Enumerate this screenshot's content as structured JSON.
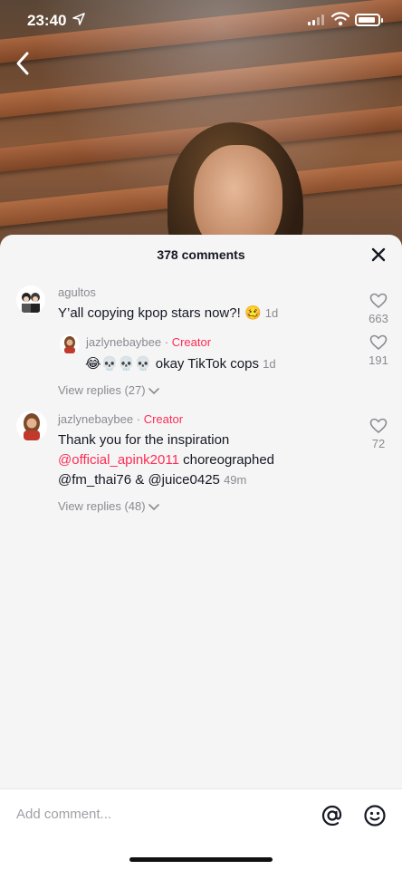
{
  "status_bar": {
    "time": "23:40"
  },
  "comments_panel": {
    "title": "378 comments",
    "comments": [
      {
        "username": "agultos",
        "text": "Y’all copying kpop stars now?! 🥴",
        "time": "1d",
        "likes": "663",
        "reply": {
          "username": "jazlynebaybee",
          "badge": "Creator",
          "text": "😂💀💀💀 okay TikTok cops",
          "time": "1d",
          "likes": "191"
        },
        "view_replies": "View replies (27)"
      },
      {
        "username": "jazlynebaybee",
        "badge": "Creator",
        "text_line1": "Thank you for the inspiration",
        "mention": "@official_apink2011",
        "text_line2_rest": " choreographed",
        "text_line3": "@fm_thai76 & @juice0425",
        "time": "49m",
        "likes": "72",
        "view_replies": "View replies (48)"
      }
    ]
  },
  "composer": {
    "placeholder": "Add comment..."
  },
  "colors": {
    "creator": "#fe2c55",
    "muted": "#8a8b91",
    "text": "#161823",
    "sheet": "#f5f5f5"
  },
  "icons": [
    "location-arrow-icon",
    "signal-icon",
    "wifi-icon",
    "battery-icon",
    "back-chevron-icon",
    "close-icon",
    "heart-icon",
    "chevron-down-icon",
    "at-icon",
    "emoji-icon"
  ]
}
